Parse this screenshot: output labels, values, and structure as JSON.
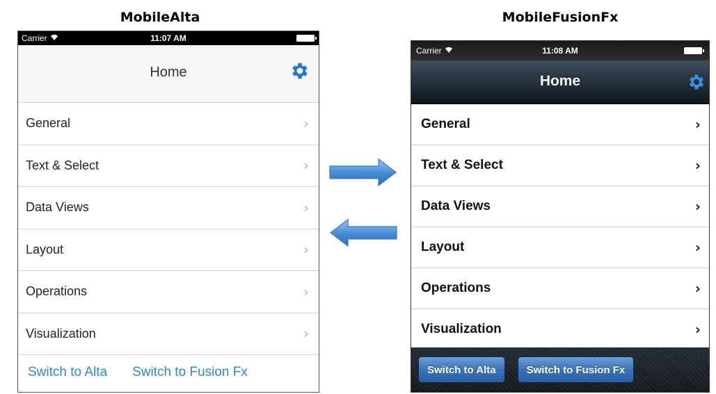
{
  "headings": {
    "left": "MobileAlta",
    "right": "MobileFusionFx"
  },
  "alta": {
    "status": {
      "carrier": "Carrier",
      "time": "11:07 AM"
    },
    "title": "Home",
    "items": [
      {
        "label": "General"
      },
      {
        "label": "Text & Select"
      },
      {
        "label": "Data Views"
      },
      {
        "label": "Layout"
      },
      {
        "label": "Operations"
      },
      {
        "label": "Visualization"
      }
    ],
    "footer": {
      "switch_alta": "Switch to Alta",
      "switch_fusion": "Switch to Fusion Fx"
    },
    "accent": "#2f87d8"
  },
  "fusion": {
    "status": {
      "carrier": "Carrier",
      "time": "11:08 AM"
    },
    "title": "Home",
    "items": [
      {
        "label": "General"
      },
      {
        "label": "Text & Select"
      },
      {
        "label": "Data Views"
      },
      {
        "label": "Layout"
      },
      {
        "label": "Operations"
      },
      {
        "label": "Visualization"
      }
    ],
    "footer": {
      "switch_alta": "Switch to Alta",
      "switch_fusion": "Switch to Fusion Fx"
    },
    "accent": "#3b73b8"
  },
  "chevron_glyph": "›",
  "icons": {
    "settings": "gear-icon",
    "wifi": "wifi-icon",
    "battery": "battery-icon",
    "arrow_right": "arrow-right-icon",
    "arrow_left": "arrow-left-icon"
  }
}
